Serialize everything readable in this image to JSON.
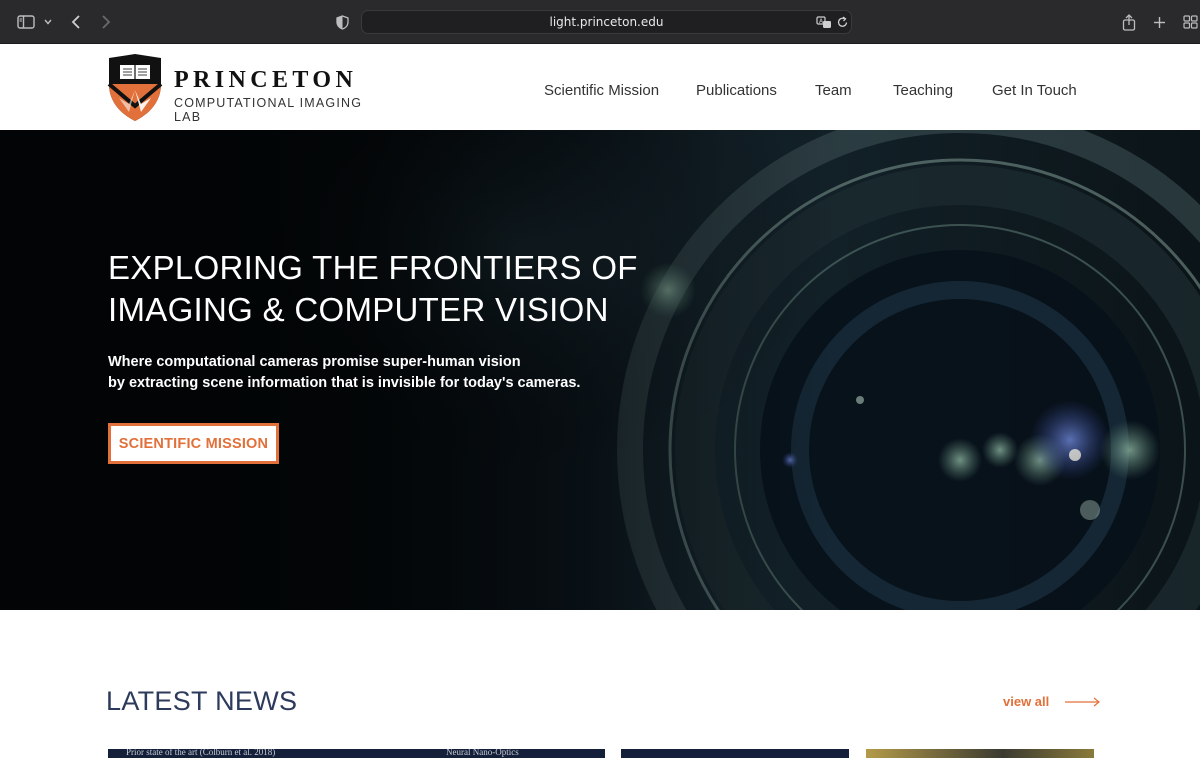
{
  "browser": {
    "url": "light.princeton.edu"
  },
  "site": {
    "logo_word": "PRINCETON",
    "logo_sub": "COMPUTATIONAL IMAGING LAB",
    "nav": [
      "Scientific Mission",
      "Publications",
      "Team",
      "Teaching",
      "Get In Touch"
    ]
  },
  "hero": {
    "title_line1": "EXPLORING THE FRONTIERS OF",
    "title_line2": "IMAGING & COMPUTER VISION",
    "sub_line1": "Where computational cameras promise super-human vision",
    "sub_line2": "by extracting scene information that is invisible for today's cameras.",
    "button": "SCIENTIFIC MISSION"
  },
  "news": {
    "title": "LATEST NEWS",
    "view_all": "view all",
    "cards": [
      {
        "caption_left": "Prior state of the art (Colburn et al. 2018)",
        "caption_right": "Neural Nano-Optics"
      },
      {
        "caption_left": ""
      },
      {
        "caption_left": ""
      }
    ]
  },
  "colors": {
    "accent": "#e2703a",
    "heading_navy": "#2c3a5c",
    "chrome_bg": "#2a2a2c"
  },
  "icons": [
    "sidebar-icon",
    "chevron-down-icon",
    "back-icon",
    "forward-icon",
    "shield-privacy-icon",
    "translate-icon",
    "reload-icon",
    "share-icon",
    "new-tab-icon",
    "tab-overview-icon",
    "arrow-right-icon"
  ]
}
